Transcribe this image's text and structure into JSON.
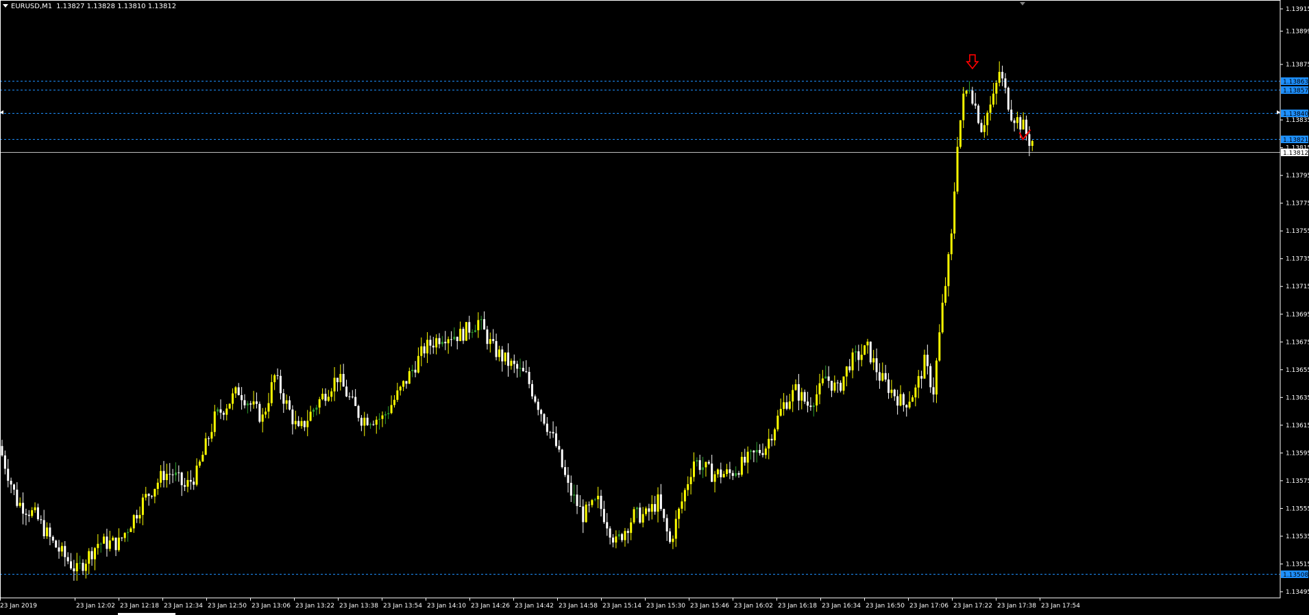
{
  "header": {
    "symbol": "EURUSD,M1",
    "ohlc": "1.13827 1.13828 1.13810 1.13812"
  },
  "colors": {
    "background": "#000000",
    "axis": "#ffffff",
    "bull_candle": "#ffff00",
    "bear_candle": "#ffffff",
    "bull_small": "#2e9e2e",
    "level_line": "#1e90ff",
    "level_tag_bg": "#1e90ff",
    "level_tag_text": "#000000",
    "current_price_line": "#c0c0c0",
    "arrow_marker": "#ff0000"
  },
  "chart_data": {
    "type": "candlestick",
    "symbol": "EURUSD",
    "timeframe": "M1",
    "ylim": [
      1.13485,
      1.1392
    ],
    "y_ticks": [
      "1.13915",
      "1.13899",
      "1.13875",
      "1.13835",
      "1.13815",
      "1.13795",
      "1.13775",
      "1.13755",
      "1.13735",
      "1.13715",
      "1.13695",
      "1.13675",
      "1.13655",
      "1.13635",
      "1.13615",
      "1.13595",
      "1.13575",
      "1.13555",
      "1.13535",
      "1.13515",
      "1.13495"
    ],
    "x_ticks": [
      "23 Jan 2019",
      "23 Jan 12:02",
      "23 Jan 12:18",
      "23 Jan 12:34",
      "23 Jan 12:50",
      "23 Jan 13:06",
      "23 Jan 13:22",
      "23 Jan 13:38",
      "23 Jan 13:54",
      "23 Jan 14:10",
      "23 Jan 14:26",
      "23 Jan 14:42",
      "23 Jan 14:58",
      "23 Jan 15:14",
      "23 Jan 15:30",
      "23 Jan 15:46",
      "23 Jan 16:02",
      "23 Jan 16:18",
      "23 Jan 16:34",
      "23 Jan 16:50",
      "23 Jan 17:06",
      "23 Jan 17:22",
      "23 Jan 17:38",
      "23 Jan 17:54"
    ],
    "horizontal_levels": [
      {
        "price": 1.13863,
        "label": "1.13863"
      },
      {
        "price": 1.13857,
        "label": "1.13857"
      },
      {
        "price": 1.1384,
        "label": "1.13840"
      },
      {
        "price": 1.13821,
        "label": "1.13821"
      },
      {
        "price": 1.13508,
        "label": "1.13508"
      }
    ],
    "current_price": {
      "price": 1.13812,
      "label": "1.13812"
    },
    "price_path": [
      [
        0,
        1.136
      ],
      [
        6,
        1.1356
      ],
      [
        12,
        1.1355
      ],
      [
        18,
        1.1353
      ],
      [
        26,
        1.1351
      ],
      [
        33,
        1.1353
      ],
      [
        40,
        1.1353
      ],
      [
        48,
        1.1356
      ],
      [
        55,
        1.1358
      ],
      [
        58,
        1.1358
      ],
      [
        62,
        1.1357
      ],
      [
        66,
        1.1358
      ],
      [
        72,
        1.1362
      ],
      [
        80,
        1.1364
      ],
      [
        88,
        1.1362
      ],
      [
        92,
        1.1365
      ],
      [
        96,
        1.1363
      ],
      [
        100,
        1.1361
      ],
      [
        106,
        1.1363
      ],
      [
        113,
        1.1365
      ],
      [
        118,
        1.1363
      ],
      [
        121,
        1.1362
      ],
      [
        128,
        1.1362
      ],
      [
        134,
        1.1364
      ],
      [
        142,
        1.1367
      ],
      [
        148,
        1.1368
      ],
      [
        154,
        1.1368
      ],
      [
        160,
        1.1369
      ],
      [
        165,
        1.1367
      ],
      [
        170,
        1.1366
      ],
      [
        176,
        1.1365
      ],
      [
        180,
        1.1363
      ],
      [
        186,
        1.136
      ],
      [
        190,
        1.1357
      ],
      [
        195,
        1.1355
      ],
      [
        200,
        1.1356
      ],
      [
        206,
        1.1353
      ],
      [
        212,
        1.1355
      ],
      [
        216,
        1.1355
      ],
      [
        220,
        1.1356
      ],
      [
        224,
        1.1353
      ],
      [
        228,
        1.1356
      ],
      [
        232,
        1.1359
      ],
      [
        238,
        1.1358
      ],
      [
        244,
        1.1358
      ],
      [
        250,
        1.1359
      ],
      [
        256,
        1.136
      ],
      [
        262,
        1.1363
      ],
      [
        266,
        1.1364
      ],
      [
        270,
        1.1363
      ],
      [
        274,
        1.1364
      ],
      [
        276,
        1.1365
      ],
      [
        280,
        1.1364
      ],
      [
        284,
        1.1366
      ],
      [
        290,
        1.1367
      ],
      [
        294,
        1.1365
      ],
      [
        298,
        1.1364
      ],
      [
        302,
        1.1363
      ],
      [
        306,
        1.1364
      ],
      [
        309,
        1.1366
      ],
      [
        312,
        1.1364
      ],
      [
        315,
        1.137
      ],
      [
        318,
        1.1375
      ],
      [
        320,
        1.1382
      ],
      [
        322,
        1.1385
      ],
      [
        324,
        1.1386
      ],
      [
        328,
        1.1383
      ],
      [
        332,
        1.1385
      ],
      [
        334,
        1.1387
      ],
      [
        338,
        1.1384
      ],
      [
        342,
        1.1383
      ],
      [
        344,
        1.1382
      ]
    ],
    "markers": [
      {
        "type": "sell-arrow",
        "index": 324,
        "price": 1.13875
      },
      {
        "type": "close-check",
        "index": 342,
        "price": 1.13822
      }
    ]
  }
}
